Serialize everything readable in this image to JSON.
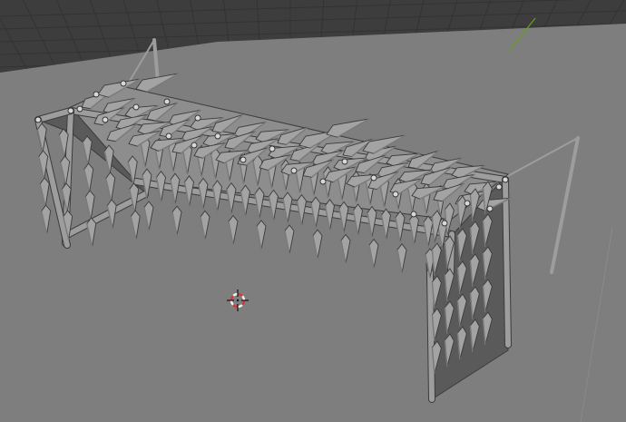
{
  "app": "3d-viewport",
  "viewport": {
    "background_color": "#3d3d3d",
    "floor_color": "#7e7e7e",
    "grid_line_color": "#4f4f4f",
    "y_axis_color": "#6aa01c"
  },
  "model": {
    "description_icon": "rig-bones-model",
    "bone_color": "#a3a3a3",
    "bone_dark_color": "#7b7b7b",
    "bone_outline_color": "#3b3b3b",
    "panel_color": "#5a5a5a",
    "beam_color": "#9d9d9d",
    "joint_color": "#d8d8d8"
  },
  "origin": {
    "icon": "3d-cursor-icon",
    "ring_color_a": "#d03a3a",
    "ring_color_b": "#f0f0f0"
  }
}
